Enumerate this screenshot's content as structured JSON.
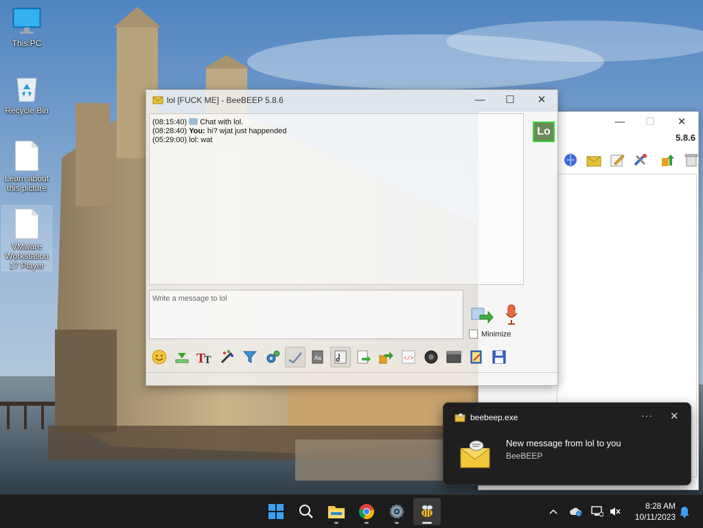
{
  "desktop": {
    "icons": [
      {
        "label": "This PC"
      },
      {
        "label": "Recycle Bin"
      },
      {
        "label": "Learn about this picture"
      },
      {
        "label": "VMware Workstation 17 Player"
      }
    ]
  },
  "chat_window": {
    "title": "lol [FUCK ME] - BeeBEEP 5.8.6",
    "messages": [
      {
        "time": "(08:15:40)",
        "text": "Chat with lol."
      },
      {
        "time": "(08:28:40)",
        "sender": "You:",
        "text": "hi? wjat just happended"
      },
      {
        "time": "(05:29:00)",
        "sender": "lol:",
        "text": "wat"
      }
    ],
    "input_placeholder": "Write a message to lol",
    "minimize_label": "Minimize",
    "avatar_text": "Lo"
  },
  "back_window": {
    "version": "5.8.6"
  },
  "toast": {
    "app_name": "beebeep.exe",
    "more": "···",
    "close": "✕",
    "title": "New message from lol to you",
    "body": "BeeBEEP"
  },
  "taskbar": {
    "time": "8:28 AM",
    "date": "10/11/2023"
  },
  "colors": {
    "accent": "#0078d4",
    "taskbar_bg": "#1c1c1c",
    "toast_bg": "#1f1f1f",
    "avatar_border": "#3bd43b"
  }
}
